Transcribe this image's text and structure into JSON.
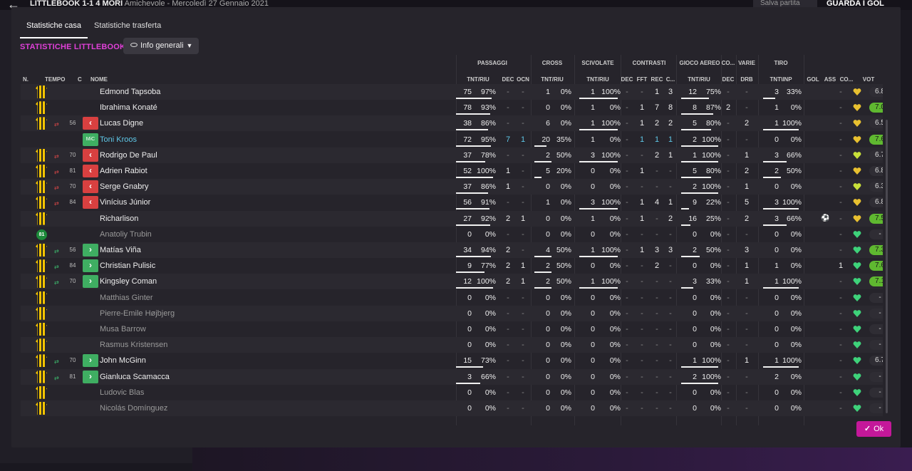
{
  "background": {
    "title_bold": "LITTLEBOOK 1-1 4 MORI",
    "title_rest": " Amichevole - Mercoledì 27 Gennaio 2021",
    "save_label": "Salva partita",
    "watch_label": "GUARDA I GOL"
  },
  "tabs": [
    {
      "label": "Statistiche casa",
      "active": true
    },
    {
      "label": "Statistiche trasferta",
      "active": false
    }
  ],
  "section_title": "STATISTICHE LITTLEBOOK",
  "view_selector": {
    "label": "Info generali"
  },
  "groups": {
    "passaggi": "PASSAGGI",
    "cross": "CROSS",
    "scivolate": "SCIVOLATE",
    "contrasti": "CONTRASTI",
    "gioco_aereo": "GIOCO AEREO",
    "co": "CO...",
    "varie": "VARIE",
    "tiro": "TIRO"
  },
  "columns": {
    "n": "N.",
    "tempo": "TEMPO",
    "c": "C",
    "nome": "NOME",
    "pass_tnt": "TNT/RIU",
    "pass_dec": "DEC",
    "pass_ocn": "OCN",
    "cross_tnt": "TNT/RIU",
    "sciv_tnt": "TNT/RIU",
    "con_dec": "DEC",
    "con_fft": "FFT",
    "con_rec": "REC",
    "con_c": "C...",
    "aereo_tnt": "TNT/RIU",
    "co_dec": "DEC",
    "varie_drb": "DRB",
    "tiro_tnt": "TNT\\INP",
    "gol": "GOL",
    "ass": "ASS",
    "co2": "CO...",
    "vot": "VOT"
  },
  "players": [
    {
      "name": "Edmond Tapsoba",
      "kit": "kit",
      "sub": "",
      "time": "",
      "pos": "",
      "pass": [
        "75",
        "97%"
      ],
      "pass_fill": 0.97,
      "pdec": "-",
      "pocn": "-",
      "cross": [
        "1",
        "0%"
      ],
      "cross_fill": 0.0,
      "sciv": [
        "1",
        "100%"
      ],
      "sciv_fill": 1.0,
      "cdec": "-",
      "cfft": "-",
      "crec": "1",
      "cc": "3",
      "aereo": [
        "12",
        "75%"
      ],
      "aereo_fill": 0.75,
      "codec": "-",
      "drb": "-",
      "tiro": [
        "3",
        "33%"
      ],
      "tiro_fill": 0.33,
      "gol": "",
      "ass": "-",
      "vot": "6.8",
      "vot_green": false,
      "heart": "yellow"
    },
    {
      "name": "Ibrahima Konaté",
      "kit": "kit",
      "sub": "",
      "time": "",
      "pos": "",
      "pass": [
        "78",
        "93%"
      ],
      "pass_fill": 0.93,
      "pdec": "-",
      "pocn": "-",
      "cross": [
        "0",
        "0%"
      ],
      "cross_fill": 0.0,
      "sciv": [
        "1",
        "0%"
      ],
      "sciv_fill": 0.0,
      "cdec": "-",
      "cfft": "1",
      "crec": "7",
      "cc": "8",
      "aereo": [
        "8",
        "87%"
      ],
      "aereo_fill": 0.87,
      "codec": "2",
      "drb": "-",
      "tiro": [
        "1",
        "0%"
      ],
      "tiro_fill": 0.0,
      "gol": "",
      "ass": "-",
      "vot": "7.0",
      "vot_green": true,
      "heart": "yellow"
    },
    {
      "name": "Lucas Digne",
      "kit": "kit",
      "sub": "out",
      "time": "56",
      "pos": "",
      "pass": [
        "38",
        "86%"
      ],
      "pass_fill": 0.86,
      "pdec": "-",
      "pocn": "-",
      "cross": [
        "6",
        "0%"
      ],
      "cross_fill": 0.0,
      "sciv": [
        "1",
        "100%"
      ],
      "sciv_fill": 1.0,
      "cdec": "-",
      "cfft": "1",
      "crec": "2",
      "cc": "2",
      "aereo": [
        "5",
        "80%"
      ],
      "aereo_fill": 0.8,
      "codec": "-",
      "drb": "2",
      "tiro": [
        "1",
        "100%"
      ],
      "tiro_fill": 1.0,
      "gol": "",
      "ass": "-",
      "vot": "6.5",
      "vot_green": false,
      "heart": "yellow"
    },
    {
      "name": "Toni Kroos",
      "kit": "",
      "sub": "",
      "time": "",
      "pos": "MiC",
      "pass": [
        "72",
        "95%"
      ],
      "pass_fill": 0.95,
      "pdec": "7",
      "pocn": "1",
      "cross": [
        "20",
        "35%"
      ],
      "cross_fill": 0.35,
      "sciv": [
        "1",
        "0%"
      ],
      "sciv_fill": 0.0,
      "cdec": "-",
      "cfft": "1",
      "crec": "1",
      "cc": "1",
      "aereo": [
        "2",
        "100%"
      ],
      "aereo_fill": 1.0,
      "codec": "-",
      "drb": "-",
      "tiro": [
        "0",
        "0%"
      ],
      "tiro_fill": 0.0,
      "gol": "",
      "ass": "-",
      "vot": "7.6",
      "vot_green": true,
      "heart": "yellow",
      "highlight": true
    },
    {
      "name": "Rodrigo De Paul",
      "kit": "kit",
      "sub": "out",
      "time": "70",
      "pos": "",
      "pass": [
        "37",
        "78%"
      ],
      "pass_fill": 0.78,
      "pdec": "-",
      "pocn": "-",
      "cross": [
        "2",
        "50%"
      ],
      "cross_fill": 0.5,
      "sciv": [
        "3",
        "100%"
      ],
      "sciv_fill": 1.0,
      "cdec": "-",
      "cfft": "-",
      "crec": "2",
      "cc": "1",
      "aereo": [
        "1",
        "100%"
      ],
      "aereo_fill": 1.0,
      "codec": "-",
      "drb": "1",
      "tiro": [
        "3",
        "66%"
      ],
      "tiro_fill": 0.66,
      "gol": "",
      "ass": "-",
      "vot": "6.7",
      "vot_green": false,
      "heart": "yellowgreen"
    },
    {
      "name": "Adrien Rabiot",
      "kit": "kit",
      "sub": "out",
      "time": "81",
      "pos": "",
      "pass": [
        "52",
        "100%"
      ],
      "pass_fill": 1.0,
      "pdec": "1",
      "pocn": "-",
      "cross": [
        "5",
        "20%"
      ],
      "cross_fill": 0.2,
      "sciv": [
        "0",
        "0%"
      ],
      "sciv_fill": 0.0,
      "cdec": "-",
      "cfft": "1",
      "crec": "-",
      "cc": "-",
      "aereo": [
        "5",
        "80%"
      ],
      "aereo_fill": 0.8,
      "codec": "-",
      "drb": "2",
      "tiro": [
        "2",
        "50%"
      ],
      "tiro_fill": 0.5,
      "gol": "",
      "ass": "-",
      "vot": "6.8",
      "vot_green": false,
      "heart": "yellow"
    },
    {
      "name": "Serge Gnabry",
      "kit": "kit",
      "sub": "out",
      "time": "70",
      "pos": "",
      "pass": [
        "37",
        "86%"
      ],
      "pass_fill": 0.86,
      "pdec": "1",
      "pocn": "-",
      "cross": [
        "0",
        "0%"
      ],
      "cross_fill": 0.0,
      "sciv": [
        "0",
        "0%"
      ],
      "sciv_fill": 0.0,
      "cdec": "-",
      "cfft": "-",
      "crec": "-",
      "cc": "-",
      "aereo": [
        "2",
        "100%"
      ],
      "aereo_fill": 1.0,
      "codec": "-",
      "drb": "1",
      "tiro": [
        "0",
        "0%"
      ],
      "tiro_fill": 0.0,
      "gol": "",
      "ass": "-",
      "vot": "6.3",
      "vot_green": false,
      "heart": "yellowgreen"
    },
    {
      "name": "Vinícius Júnior",
      "kit": "kit",
      "sub": "out",
      "time": "84",
      "pos": "",
      "pass": [
        "56",
        "91%"
      ],
      "pass_fill": 0.91,
      "pdec": "-",
      "pocn": "-",
      "cross": [
        "1",
        "0%"
      ],
      "cross_fill": 0.0,
      "sciv": [
        "3",
        "100%"
      ],
      "sciv_fill": 1.0,
      "cdec": "-",
      "cfft": "1",
      "crec": "4",
      "cc": "1",
      "aereo": [
        "9",
        "22%"
      ],
      "aereo_fill": 0.22,
      "codec": "-",
      "drb": "5",
      "tiro": [
        "3",
        "100%"
      ],
      "tiro_fill": 1.0,
      "gol": "",
      "ass": "-",
      "vot": "6.8",
      "vot_green": false,
      "heart": "yellow"
    },
    {
      "name": "Richarlison",
      "kit": "kit",
      "sub": "",
      "time": "",
      "pos": "",
      "pass": [
        "27",
        "92%"
      ],
      "pass_fill": 0.92,
      "pdec": "2",
      "pocn": "1",
      "cross": [
        "0",
        "0%"
      ],
      "cross_fill": 0.0,
      "sciv": [
        "1",
        "0%"
      ],
      "sciv_fill": 0.0,
      "cdec": "-",
      "cfft": "1",
      "crec": "-",
      "cc": "2",
      "aereo": [
        "16",
        "25%"
      ],
      "aereo_fill": 0.25,
      "codec": "-",
      "drb": "2",
      "tiro": [
        "3",
        "66%"
      ],
      "tiro_fill": 0.66,
      "gol": "ball",
      "ass": "-",
      "vot": "7.5",
      "vot_green": true,
      "heart": "yellow"
    },
    {
      "name": "Anatoliy Trubin",
      "kit": "gk",
      "gk_num": "81",
      "sub": "",
      "time": "",
      "pos": "",
      "pass": [
        "0",
        "0%"
      ],
      "pass_fill": 0.0,
      "pdec": "-",
      "pocn": "-",
      "cross": [
        "0",
        "0%"
      ],
      "cross_fill": 0.0,
      "sciv": [
        "0",
        "0%"
      ],
      "sciv_fill": 0.0,
      "cdec": "-",
      "cfft": "-",
      "crec": "-",
      "cc": "-",
      "aereo": [
        "0",
        "0%"
      ],
      "aereo_fill": 0.0,
      "codec": "-",
      "drb": "-",
      "tiro": [
        "0",
        "0%"
      ],
      "tiro_fill": 0.0,
      "gol": "",
      "ass": "-",
      "vot": "-",
      "vot_green": false,
      "heart": "green",
      "dim": true
    },
    {
      "name": "Matías Viña",
      "kit": "kit",
      "sub": "in",
      "time": "56",
      "pos": "",
      "pass": [
        "34",
        "94%"
      ],
      "pass_fill": 0.94,
      "pdec": "2",
      "pocn": "-",
      "cross": [
        "4",
        "50%"
      ],
      "cross_fill": 0.5,
      "sciv": [
        "1",
        "100%"
      ],
      "sciv_fill": 1.0,
      "cdec": "-",
      "cfft": "1",
      "crec": "3",
      "cc": "3",
      "aereo": [
        "2",
        "50%"
      ],
      "aereo_fill": 0.5,
      "codec": "-",
      "drb": "3",
      "tiro": [
        "0",
        "0%"
      ],
      "tiro_fill": 0.0,
      "gol": "",
      "ass": "-",
      "vot": "7.3",
      "vot_green": true,
      "heart": "green"
    },
    {
      "name": "Christian Pulisic",
      "kit": "kit",
      "sub": "in",
      "time": "84",
      "pos": "",
      "pass": [
        "9",
        "77%"
      ],
      "pass_fill": 0.77,
      "pdec": "2",
      "pocn": "1",
      "cross": [
        "2",
        "50%"
      ],
      "cross_fill": 0.5,
      "sciv": [
        "0",
        "0%"
      ],
      "sciv_fill": 0.0,
      "cdec": "-",
      "cfft": "-",
      "crec": "2",
      "cc": "-",
      "aereo": [
        "0",
        "0%"
      ],
      "aereo_fill": 0.0,
      "codec": "-",
      "drb": "1",
      "tiro": [
        "1",
        "0%"
      ],
      "tiro_fill": 0.0,
      "gol": "",
      "ass": "1",
      "vot": "7.6",
      "vot_green": true,
      "heart": "green"
    },
    {
      "name": "Kingsley Coman",
      "kit": "kit",
      "sub": "in",
      "time": "70",
      "pos": "",
      "pass": [
        "12",
        "100%"
      ],
      "pass_fill": 1.0,
      "pdec": "2",
      "pocn": "1",
      "cross": [
        "2",
        "50%"
      ],
      "cross_fill": 0.5,
      "sciv": [
        "1",
        "100%"
      ],
      "sciv_fill": 1.0,
      "cdec": "-",
      "cfft": "-",
      "crec": "-",
      "cc": "-",
      "aereo": [
        "3",
        "33%"
      ],
      "aereo_fill": 0.33,
      "codec": "-",
      "drb": "1",
      "tiro": [
        "1",
        "100%"
      ],
      "tiro_fill": 1.0,
      "gol": "",
      "ass": "-",
      "vot": "7.1",
      "vot_green": true,
      "heart": "green"
    },
    {
      "name": "Matthias Ginter",
      "kit": "kit",
      "sub": "",
      "time": "",
      "pos": "",
      "pass": [
        "0",
        "0%"
      ],
      "pass_fill": 0.0,
      "pdec": "-",
      "pocn": "-",
      "cross": [
        "0",
        "0%"
      ],
      "cross_fill": 0.0,
      "sciv": [
        "0",
        "0%"
      ],
      "sciv_fill": 0.0,
      "cdec": "-",
      "cfft": "-",
      "crec": "-",
      "cc": "-",
      "aereo": [
        "0",
        "0%"
      ],
      "aereo_fill": 0.0,
      "codec": "-",
      "drb": "-",
      "tiro": [
        "0",
        "0%"
      ],
      "tiro_fill": 0.0,
      "gol": "",
      "ass": "-",
      "vot": "-",
      "vot_green": false,
      "heart": "green",
      "dim": true
    },
    {
      "name": "Pierre-Emile Højbjerg",
      "kit": "kit",
      "sub": "",
      "time": "",
      "pos": "",
      "pass": [
        "0",
        "0%"
      ],
      "pass_fill": 0.0,
      "pdec": "-",
      "pocn": "-",
      "cross": [
        "0",
        "0%"
      ],
      "cross_fill": 0.0,
      "sciv": [
        "0",
        "0%"
      ],
      "sciv_fill": 0.0,
      "cdec": "-",
      "cfft": "-",
      "crec": "-",
      "cc": "-",
      "aereo": [
        "0",
        "0%"
      ],
      "aereo_fill": 0.0,
      "codec": "-",
      "drb": "-",
      "tiro": [
        "0",
        "0%"
      ],
      "tiro_fill": 0.0,
      "gol": "",
      "ass": "-",
      "vot": "-",
      "vot_green": false,
      "heart": "green",
      "dim": true
    },
    {
      "name": "Musa Barrow",
      "kit": "kit",
      "sub": "",
      "time": "",
      "pos": "",
      "pass": [
        "0",
        "0%"
      ],
      "pass_fill": 0.0,
      "pdec": "-",
      "pocn": "-",
      "cross": [
        "0",
        "0%"
      ],
      "cross_fill": 0.0,
      "sciv": [
        "0",
        "0%"
      ],
      "sciv_fill": 0.0,
      "cdec": "-",
      "cfft": "-",
      "crec": "-",
      "cc": "-",
      "aereo": [
        "0",
        "0%"
      ],
      "aereo_fill": 0.0,
      "codec": "-",
      "drb": "-",
      "tiro": [
        "0",
        "0%"
      ],
      "tiro_fill": 0.0,
      "gol": "",
      "ass": "-",
      "vot": "-",
      "vot_green": false,
      "heart": "green",
      "dim": true
    },
    {
      "name": "Rasmus Kristensen",
      "kit": "kit",
      "sub": "",
      "time": "",
      "pos": "",
      "pass": [
        "0",
        "0%"
      ],
      "pass_fill": 0.0,
      "pdec": "-",
      "pocn": "-",
      "cross": [
        "0",
        "0%"
      ],
      "cross_fill": 0.0,
      "sciv": [
        "0",
        "0%"
      ],
      "sciv_fill": 0.0,
      "cdec": "-",
      "cfft": "-",
      "crec": "-",
      "cc": "-",
      "aereo": [
        "0",
        "0%"
      ],
      "aereo_fill": 0.0,
      "codec": "-",
      "drb": "-",
      "tiro": [
        "0",
        "0%"
      ],
      "tiro_fill": 0.0,
      "gol": "",
      "ass": "-",
      "vot": "-",
      "vot_green": false,
      "heart": "green",
      "dim": true
    },
    {
      "name": "John McGinn",
      "kit": "kit",
      "sub": "in",
      "time": "70",
      "pos": "",
      "pass": [
        "15",
        "73%"
      ],
      "pass_fill": 0.73,
      "pdec": "-",
      "pocn": "-",
      "cross": [
        "0",
        "0%"
      ],
      "cross_fill": 0.0,
      "sciv": [
        "0",
        "0%"
      ],
      "sciv_fill": 0.0,
      "cdec": "-",
      "cfft": "-",
      "crec": "-",
      "cc": "-",
      "aereo": [
        "1",
        "100%"
      ],
      "aereo_fill": 1.0,
      "codec": "-",
      "drb": "1",
      "tiro": [
        "1",
        "100%"
      ],
      "tiro_fill": 1.0,
      "gol": "",
      "ass": "-",
      "vot": "6.7",
      "vot_green": false,
      "heart": "green"
    },
    {
      "name": "Gianluca Scamacca",
      "kit": "kit",
      "sub": "in",
      "time": "81",
      "pos": "",
      "pass": [
        "3",
        "66%"
      ],
      "pass_fill": 0.66,
      "pdec": "-",
      "pocn": "-",
      "cross": [
        "0",
        "0%"
      ],
      "cross_fill": 0.0,
      "sciv": [
        "0",
        "0%"
      ],
      "sciv_fill": 0.0,
      "cdec": "-",
      "cfft": "-",
      "crec": "-",
      "cc": "-",
      "aereo": [
        "2",
        "100%"
      ],
      "aereo_fill": 1.0,
      "codec": "-",
      "drb": "-",
      "tiro": [
        "2",
        "0%"
      ],
      "tiro_fill": 0.0,
      "gol": "",
      "ass": "-",
      "vot": "-",
      "vot_green": false,
      "heart": "green"
    },
    {
      "name": "Ludovic Blas",
      "kit": "kit",
      "sub": "",
      "time": "",
      "pos": "",
      "pass": [
        "0",
        "0%"
      ],
      "pass_fill": 0.0,
      "pdec": "-",
      "pocn": "-",
      "cross": [
        "0",
        "0%"
      ],
      "cross_fill": 0.0,
      "sciv": [
        "0",
        "0%"
      ],
      "sciv_fill": 0.0,
      "cdec": "-",
      "cfft": "-",
      "crec": "-",
      "cc": "-",
      "aereo": [
        "0",
        "0%"
      ],
      "aereo_fill": 0.0,
      "codec": "-",
      "drb": "-",
      "tiro": [
        "0",
        "0%"
      ],
      "tiro_fill": 0.0,
      "gol": "",
      "ass": "-",
      "vot": "-",
      "vot_green": false,
      "heart": "green",
      "dim": true
    },
    {
      "name": "Nicolás Domínguez",
      "kit": "kit",
      "sub": "",
      "time": "",
      "pos": "",
      "pass": [
        "0",
        "0%"
      ],
      "pass_fill": 0.0,
      "pdec": "-",
      "pocn": "-",
      "cross": [
        "0",
        "0%"
      ],
      "cross_fill": 0.0,
      "sciv": [
        "0",
        "0%"
      ],
      "sciv_fill": 0.0,
      "cdec": "-",
      "cfft": "-",
      "crec": "-",
      "cc": "-",
      "aereo": [
        "0",
        "0%"
      ],
      "aereo_fill": 0.0,
      "codec": "-",
      "drb": "-",
      "tiro": [
        "0",
        "0%"
      ],
      "tiro_fill": 0.0,
      "gol": "",
      "ass": "-",
      "vot": "-",
      "vot_green": false,
      "heart": "green",
      "dim": true
    }
  ],
  "ok_button": {
    "label": "Ok"
  },
  "colors": {
    "accent": "#c4189a",
    "section_title": "#e040d8",
    "rating_green": "#5fb830",
    "highlight_name": "#5fc8e8"
  }
}
